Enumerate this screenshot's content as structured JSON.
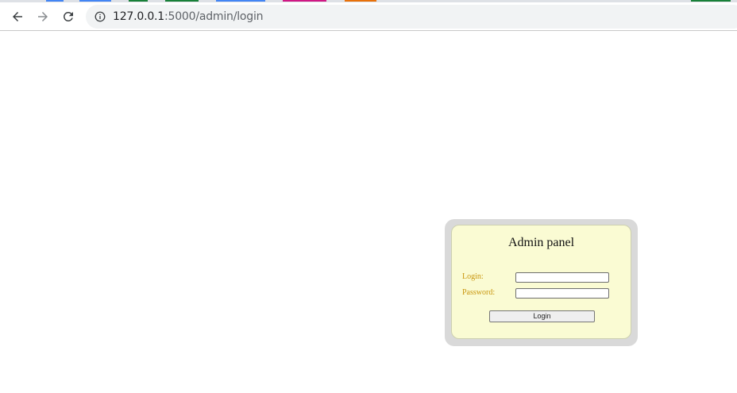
{
  "browser": {
    "url_host": "127.0.0.1",
    "url_path": ":5000/admin/login",
    "tab_colors": [
      "#4285f4",
      "#4285f4",
      "#188038",
      "#188038",
      "#4285f4",
      "#d01884",
      "#e8710a",
      "#188038"
    ]
  },
  "login_panel": {
    "title": "Admin panel",
    "login_label": "Login:",
    "password_label": "Password:",
    "login_value": "",
    "password_value": "",
    "submit_label": "Login"
  },
  "colors": {
    "panel_background": "#fafbd3",
    "panel_border": "#d9d9d9",
    "label_color": "#c8950c"
  }
}
